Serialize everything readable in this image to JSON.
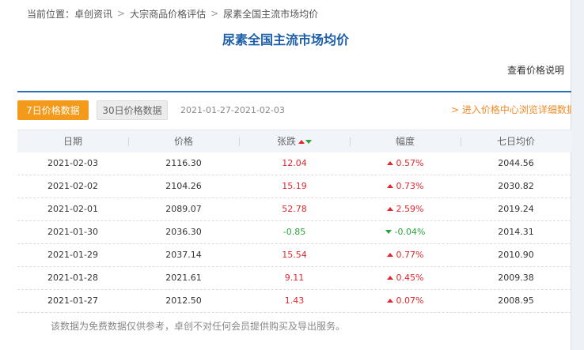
{
  "breadcrumb": {
    "label": "当前位置：",
    "items": [
      "卓创资讯",
      "大宗商品价格评估",
      "尿素全国主流市场均价"
    ],
    "separator": ">"
  },
  "page_title": "尿素全国主流市场均价",
  "price_note": "查看价格说明",
  "tabs": {
    "seven_day": "7日价格数据",
    "thirty_day": "30日价格数据"
  },
  "date_range": "2021-01-27-2021-02-03",
  "detail_link": "> 进入价格中心浏览详细数据",
  "table": {
    "headers": [
      "日期",
      "价格",
      "张跌",
      "幅度",
      "七日均价"
    ],
    "rows": [
      {
        "date": "2021-02-03",
        "price": "2116.30",
        "change": "12.04",
        "pct": "0.57%",
        "avg7": "2044.56",
        "dir": "up"
      },
      {
        "date": "2021-02-02",
        "price": "2104.26",
        "change": "15.19",
        "pct": "0.73%",
        "avg7": "2030.82",
        "dir": "up"
      },
      {
        "date": "2021-02-01",
        "price": "2089.07",
        "change": "52.78",
        "pct": "2.59%",
        "avg7": "2019.24",
        "dir": "up"
      },
      {
        "date": "2021-01-30",
        "price": "2036.30",
        "change": "-0.85",
        "pct": "-0.04%",
        "avg7": "2014.31",
        "dir": "down"
      },
      {
        "date": "2021-01-29",
        "price": "2037.14",
        "change": "15.54",
        "pct": "0.77%",
        "avg7": "2010.90",
        "dir": "up"
      },
      {
        "date": "2021-01-28",
        "price": "2021.61",
        "change": "9.11",
        "pct": "0.45%",
        "avg7": "2009.38",
        "dir": "up"
      },
      {
        "date": "2021-01-27",
        "price": "2012.50",
        "change": "1.43",
        "pct": "0.07%",
        "avg7": "2008.95",
        "dir": "up"
      }
    ]
  },
  "footnote": "该数据为免费数据仅供参考，卓创不对任何会员提供购买及导出服务。",
  "colors": {
    "title_blue": "#1d5ea8",
    "accent_orange": "#f49a1b",
    "up_red": "#e0272d",
    "down_green": "#2aa33b"
  }
}
